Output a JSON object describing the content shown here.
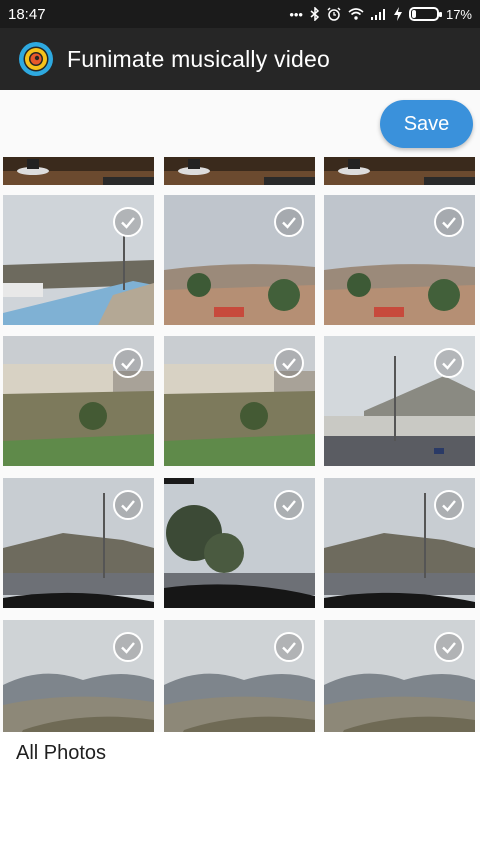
{
  "status_bar": {
    "time": "18:47",
    "battery": "17%",
    "battery_level": 0.17,
    "icons": [
      "more-icon",
      "bluetooth-icon",
      "alarm-icon",
      "wifi-icon",
      "signal-icon",
      "charging-icon",
      "battery-icon"
    ]
  },
  "app_bar": {
    "title": "Funimate musically video",
    "logo_icon": "funimate-swirl-logo"
  },
  "toolbar": {
    "save_label": "Save"
  },
  "colors": {
    "accent": "#3a91db",
    "app_bar": "#262626",
    "status_bar": "#1b1b1b"
  },
  "gallery": {
    "selected_photos": 12,
    "photos": [
      {
        "scene": "cafe-table",
        "selected": false
      },
      {
        "scene": "cafe-table",
        "selected": false
      },
      {
        "scene": "cafe-table",
        "selected": false
      },
      {
        "scene": "street-railing",
        "selected": true
      },
      {
        "scene": "city-hillside",
        "selected": true
      },
      {
        "scene": "city-hillside",
        "selected": true
      },
      {
        "scene": "apartments-field",
        "selected": true
      },
      {
        "scene": "apartments-field",
        "selected": true
      },
      {
        "scene": "road-town",
        "selected": true
      },
      {
        "scene": "windshield-road",
        "selected": true
      },
      {
        "scene": "windshield-trees",
        "selected": true
      },
      {
        "scene": "windshield-road",
        "selected": true
      },
      {
        "scene": "mountains",
        "selected": true
      },
      {
        "scene": "mountains",
        "selected": true
      },
      {
        "scene": "mountains",
        "selected": true
      }
    ]
  },
  "footer": {
    "album_label": "All Photos"
  }
}
